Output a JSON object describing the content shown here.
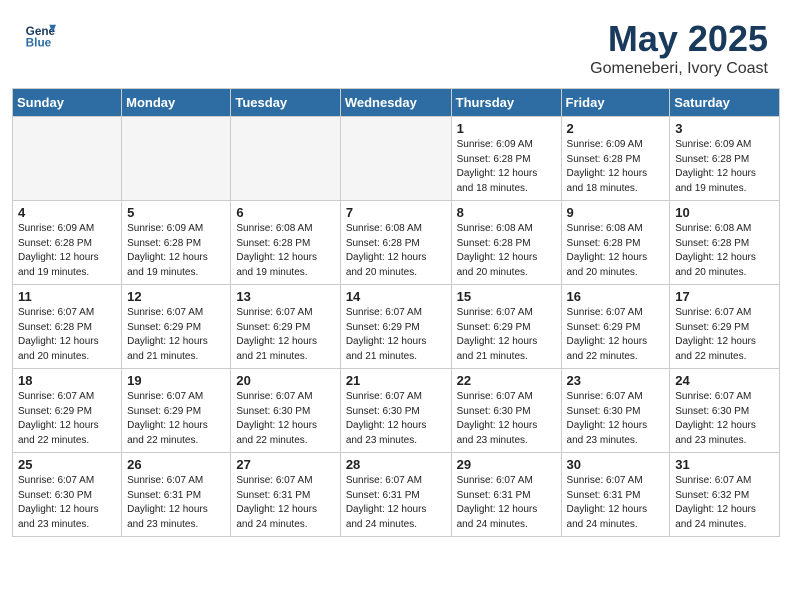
{
  "header": {
    "logo_line1": "General",
    "logo_line2": "Blue",
    "month": "May 2025",
    "location": "Gomeneberi, Ivory Coast"
  },
  "weekdays": [
    "Sunday",
    "Monday",
    "Tuesday",
    "Wednesday",
    "Thursday",
    "Friday",
    "Saturday"
  ],
  "weeks": [
    [
      {
        "day": "",
        "info": ""
      },
      {
        "day": "",
        "info": ""
      },
      {
        "day": "",
        "info": ""
      },
      {
        "day": "",
        "info": ""
      },
      {
        "day": "1",
        "info": "Sunrise: 6:09 AM\nSunset: 6:28 PM\nDaylight: 12 hours\nand 18 minutes."
      },
      {
        "day": "2",
        "info": "Sunrise: 6:09 AM\nSunset: 6:28 PM\nDaylight: 12 hours\nand 18 minutes."
      },
      {
        "day": "3",
        "info": "Sunrise: 6:09 AM\nSunset: 6:28 PM\nDaylight: 12 hours\nand 19 minutes."
      }
    ],
    [
      {
        "day": "4",
        "info": "Sunrise: 6:09 AM\nSunset: 6:28 PM\nDaylight: 12 hours\nand 19 minutes."
      },
      {
        "day": "5",
        "info": "Sunrise: 6:09 AM\nSunset: 6:28 PM\nDaylight: 12 hours\nand 19 minutes."
      },
      {
        "day": "6",
        "info": "Sunrise: 6:08 AM\nSunset: 6:28 PM\nDaylight: 12 hours\nand 19 minutes."
      },
      {
        "day": "7",
        "info": "Sunrise: 6:08 AM\nSunset: 6:28 PM\nDaylight: 12 hours\nand 20 minutes."
      },
      {
        "day": "8",
        "info": "Sunrise: 6:08 AM\nSunset: 6:28 PM\nDaylight: 12 hours\nand 20 minutes."
      },
      {
        "day": "9",
        "info": "Sunrise: 6:08 AM\nSunset: 6:28 PM\nDaylight: 12 hours\nand 20 minutes."
      },
      {
        "day": "10",
        "info": "Sunrise: 6:08 AM\nSunset: 6:28 PM\nDaylight: 12 hours\nand 20 minutes."
      }
    ],
    [
      {
        "day": "11",
        "info": "Sunrise: 6:07 AM\nSunset: 6:28 PM\nDaylight: 12 hours\nand 20 minutes."
      },
      {
        "day": "12",
        "info": "Sunrise: 6:07 AM\nSunset: 6:29 PM\nDaylight: 12 hours\nand 21 minutes."
      },
      {
        "day": "13",
        "info": "Sunrise: 6:07 AM\nSunset: 6:29 PM\nDaylight: 12 hours\nand 21 minutes."
      },
      {
        "day": "14",
        "info": "Sunrise: 6:07 AM\nSunset: 6:29 PM\nDaylight: 12 hours\nand 21 minutes."
      },
      {
        "day": "15",
        "info": "Sunrise: 6:07 AM\nSunset: 6:29 PM\nDaylight: 12 hours\nand 21 minutes."
      },
      {
        "day": "16",
        "info": "Sunrise: 6:07 AM\nSunset: 6:29 PM\nDaylight: 12 hours\nand 22 minutes."
      },
      {
        "day": "17",
        "info": "Sunrise: 6:07 AM\nSunset: 6:29 PM\nDaylight: 12 hours\nand 22 minutes."
      }
    ],
    [
      {
        "day": "18",
        "info": "Sunrise: 6:07 AM\nSunset: 6:29 PM\nDaylight: 12 hours\nand 22 minutes."
      },
      {
        "day": "19",
        "info": "Sunrise: 6:07 AM\nSunset: 6:29 PM\nDaylight: 12 hours\nand 22 minutes."
      },
      {
        "day": "20",
        "info": "Sunrise: 6:07 AM\nSunset: 6:30 PM\nDaylight: 12 hours\nand 22 minutes."
      },
      {
        "day": "21",
        "info": "Sunrise: 6:07 AM\nSunset: 6:30 PM\nDaylight: 12 hours\nand 23 minutes."
      },
      {
        "day": "22",
        "info": "Sunrise: 6:07 AM\nSunset: 6:30 PM\nDaylight: 12 hours\nand 23 minutes."
      },
      {
        "day": "23",
        "info": "Sunrise: 6:07 AM\nSunset: 6:30 PM\nDaylight: 12 hours\nand 23 minutes."
      },
      {
        "day": "24",
        "info": "Sunrise: 6:07 AM\nSunset: 6:30 PM\nDaylight: 12 hours\nand 23 minutes."
      }
    ],
    [
      {
        "day": "25",
        "info": "Sunrise: 6:07 AM\nSunset: 6:30 PM\nDaylight: 12 hours\nand 23 minutes."
      },
      {
        "day": "26",
        "info": "Sunrise: 6:07 AM\nSunset: 6:31 PM\nDaylight: 12 hours\nand 23 minutes."
      },
      {
        "day": "27",
        "info": "Sunrise: 6:07 AM\nSunset: 6:31 PM\nDaylight: 12 hours\nand 24 minutes."
      },
      {
        "day": "28",
        "info": "Sunrise: 6:07 AM\nSunset: 6:31 PM\nDaylight: 12 hours\nand 24 minutes."
      },
      {
        "day": "29",
        "info": "Sunrise: 6:07 AM\nSunset: 6:31 PM\nDaylight: 12 hours\nand 24 minutes."
      },
      {
        "day": "30",
        "info": "Sunrise: 6:07 AM\nSunset: 6:31 PM\nDaylight: 12 hours\nand 24 minutes."
      },
      {
        "day": "31",
        "info": "Sunrise: 6:07 AM\nSunset: 6:32 PM\nDaylight: 12 hours\nand 24 minutes."
      }
    ]
  ]
}
